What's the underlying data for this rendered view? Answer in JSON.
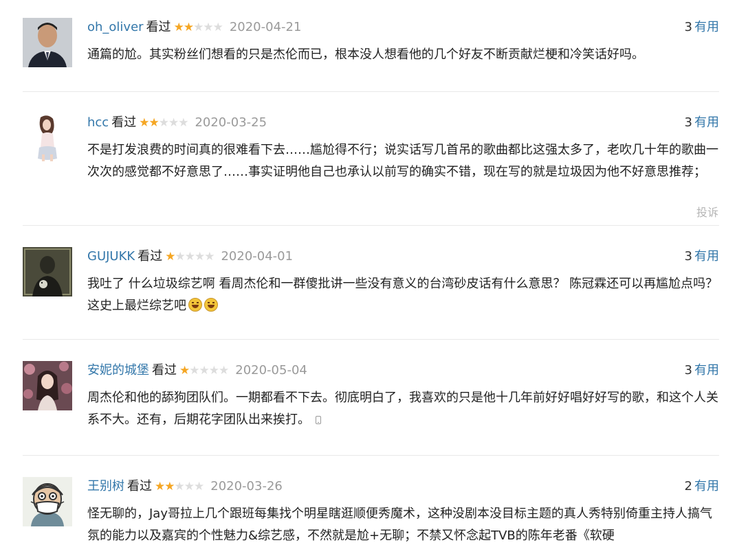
{
  "reviews": [
    {
      "user": "oh_oliver",
      "status": "看过",
      "rating": 2,
      "rating_max": 5,
      "date": "2020-04-21",
      "votes": "3",
      "vote_label": "有用",
      "avatar_icon": "avatar-photo-man-suit-icon",
      "content": "通篇的尬。其实粉丝们想看的只是杰伦而已，根本没人想看他的几个好友不断贡献烂梗和冷笑话好吗。"
    },
    {
      "user": "hcc",
      "status": "看过",
      "rating": 2,
      "rating_max": 5,
      "date": "2020-03-25",
      "votes": "3",
      "vote_label": "有用",
      "avatar_icon": "avatar-photo-woman-sitting-icon",
      "content": "不是打发浪费的时间真的很难看下去……尴尬得不行；说实话写几首吊的歌曲都比这强太多了，老吹几十年的歌曲一次次的感觉都不好意思了……事实证明他自己也承认以前写的确实不错，现在写的就是垃圾因为他不好意思推荐；",
      "report_label": "投诉"
    },
    {
      "user": "GUJUKK",
      "status": "看过",
      "rating": 1,
      "rating_max": 5,
      "date": "2020-04-01",
      "votes": "3",
      "vote_label": "有用",
      "avatar_icon": "avatar-photo-dark-portrait-icon",
      "content": "我吐了 什么垃圾综艺啊 看周杰伦和一群傻批讲一些没有意义的台湾砂皮话有什么意思？ 陈冠霖还可以再尴尬点吗？ 这史上最烂综艺吧",
      "emoji": [
        "laughing-emoji-icon",
        "laughing-emoji-icon"
      ]
    },
    {
      "user": "安妮的城堡",
      "status": "看过",
      "rating": 1,
      "rating_max": 5,
      "date": "2020-05-04",
      "votes": "3",
      "vote_label": "有用",
      "avatar_icon": "avatar-photo-woman-flowers-icon",
      "content": "周杰伦和他的舔狗团队们。一期都看不下去。彻底明白了，我喜欢的只是他十几年前好好唱好好写的歌，和这个人关系不大。还有，后期花字团队出来挨打。",
      "trail_icon": "mobile-phone-icon"
    },
    {
      "user": "王别树",
      "status": "看过",
      "rating": 2,
      "rating_max": 5,
      "date": "2020-03-26",
      "votes": "2",
      "vote_label": "有用",
      "avatar_icon": "avatar-cartoon-masked-man-icon",
      "content": "怪无聊的，Jay哥拉上几个跟班每集找个明星瞎逛顺便秀魔术，这种没剧本没目标主题的真人秀特别倚重主持人搞气氛的能力以及嘉宾的个性魅力&综艺感，不然就是尬+无聊；不禁又怀念起TVB的陈年老番《软硬"
    }
  ]
}
